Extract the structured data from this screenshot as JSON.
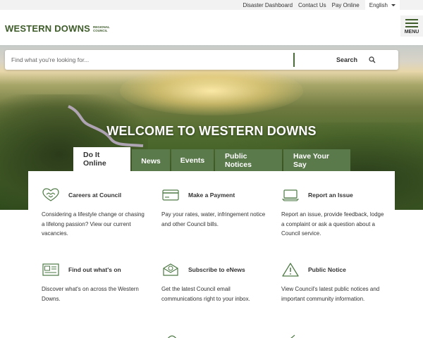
{
  "utility_bar": {
    "links": [
      "Disaster Dashboard",
      "Contact Us",
      "Pay Online"
    ],
    "language": "English"
  },
  "header": {
    "logo_main": "WESTERN DOWNS",
    "logo_sub_1": "REGIONAL",
    "logo_sub_2": "COUNCIL",
    "menu_label": "MENU"
  },
  "search": {
    "placeholder": "Find what you're looking for...",
    "button_label": "Search"
  },
  "hero": {
    "title": "WELCOME TO WESTERN DOWNS"
  },
  "tabs": [
    {
      "label": "Do It Online",
      "active": true
    },
    {
      "label": "News",
      "active": false
    },
    {
      "label": "Events",
      "active": false
    },
    {
      "label": "Public Notices",
      "active": false
    },
    {
      "label": "Have Your Say",
      "active": false
    }
  ],
  "cards": [
    {
      "title": "Careers at Council",
      "icon": "handshake-icon",
      "desc": "Considering a lifestyle change or chasing a lifelong passion? View our current vacancies."
    },
    {
      "title": "Make a Payment",
      "icon": "credit-card-icon",
      "desc": "Pay your rates, water, infringement notice and other Council bills."
    },
    {
      "title": "Report an Issue",
      "icon": "laptop-icon",
      "desc": "Report an issue, provide feedback, lodge a complaint or ask a question about a Council service."
    },
    {
      "title": "Find out what's on",
      "icon": "newspaper-icon",
      "desc": "Discover what's on across the Western Downs."
    },
    {
      "title": "Subscribe to eNews",
      "icon": "email-open-icon",
      "desc": "Get the latest Council email communications right to your inbox."
    },
    {
      "title": "Public Notice",
      "icon": "warning-icon",
      "desc": "View Council's latest public notices and important community information."
    }
  ],
  "colors": {
    "brand_green": "#3e5c2a",
    "tab_green": "#5a7a4c",
    "icon_green": "#4e7a45"
  }
}
